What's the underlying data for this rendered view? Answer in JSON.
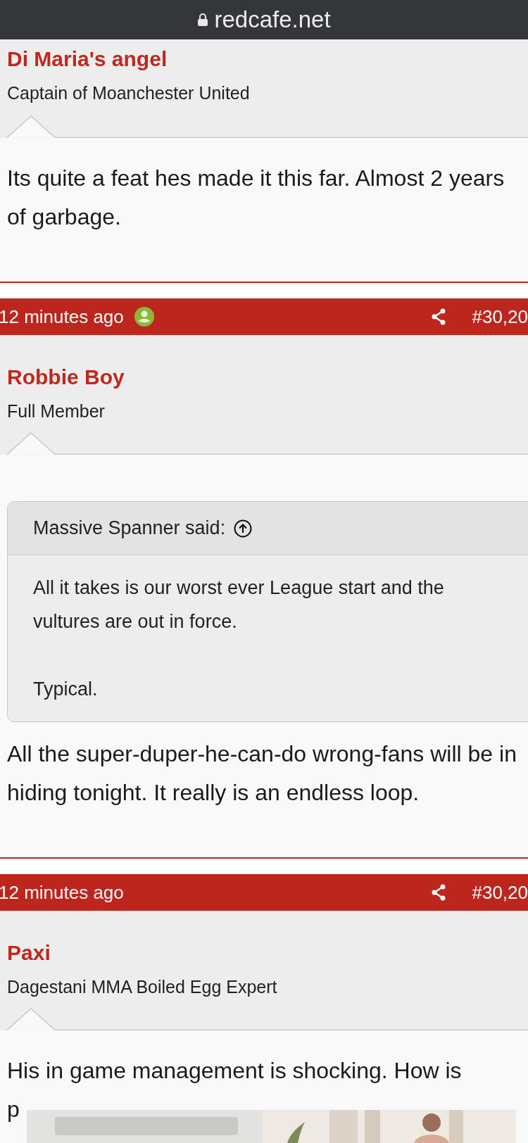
{
  "address_bar": {
    "url": "redcafe.net"
  },
  "posts": [
    {
      "author": "Di Maria's angel",
      "user_title": "Captain of Moanchester United",
      "body": [
        "Its quite a feat hes made it this far. Almost 2 years",
        "of garbage."
      ]
    },
    {
      "header": {
        "time": "12 minutes ago",
        "online": true,
        "number": "#30,20"
      },
      "author": "Robbie Boy",
      "user_title": "Full Member",
      "quote": {
        "author": "Massive Spanner said:",
        "paragraphs": [
          [
            "All it takes is our worst ever League start and the",
            "vultures are out in force."
          ],
          [
            "Typical."
          ]
        ]
      },
      "body": [
        "All the super-duper-he-can-do wrong-fans will be in",
        "hiding tonight. It really is an endless loop."
      ]
    },
    {
      "header": {
        "time": "12 minutes ago",
        "online": false,
        "number": "#30,20"
      },
      "author": "Paxi",
      "user_title": "Dagestani MMA Boiled Egg Expert",
      "body": [
        "His in game management is shocking. How is",
        "p"
      ]
    }
  ]
}
